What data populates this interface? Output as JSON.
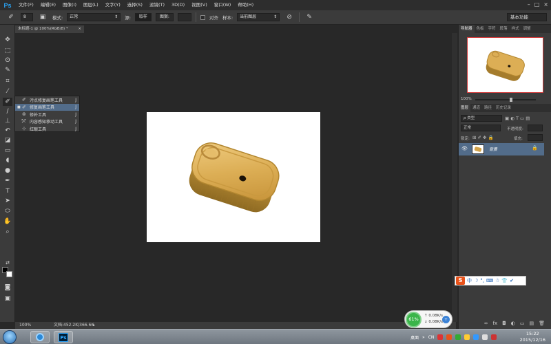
{
  "app": {
    "logo": "Ps",
    "menu": [
      "文件(F)",
      "编辑(E)",
      "图像(I)",
      "图层(L)",
      "文字(Y)",
      "选择(S)",
      "滤镜(T)",
      "3D(D)",
      "视图(V)",
      "窗口(W)",
      "帮助(H)"
    ],
    "window_controls": [
      "–",
      "□",
      "×"
    ]
  },
  "options": {
    "brush_size": "8",
    "mode_label": "模式:",
    "mode_value": "正常",
    "source_label": "源:",
    "source_sampled": "取样",
    "source_pattern": "图案:",
    "aligned_label": "对齐",
    "sample_label": "样本:",
    "sample_value": "当前图层",
    "workspace": "基本功能"
  },
  "document": {
    "tab_title": "未标题-1 @ 100%(RGB/8) *",
    "close": "×",
    "canvas_background": "#ffffff"
  },
  "tools": [
    {
      "name": "move-tool-icon",
      "glyph": "✥"
    },
    {
      "name": "marquee-tool-icon",
      "glyph": "⬚"
    },
    {
      "name": "lasso-tool-icon",
      "glyph": "ʘ"
    },
    {
      "name": "quick-select-tool-icon",
      "glyph": "✎"
    },
    {
      "name": "crop-tool-icon",
      "glyph": "⌗"
    },
    {
      "name": "eyedropper-tool-icon",
      "glyph": "⁄"
    },
    {
      "name": "healing-brush-tool-icon",
      "glyph": "✐"
    },
    {
      "name": "brush-tool-icon",
      "glyph": "∕"
    },
    {
      "name": "clone-stamp-tool-icon",
      "glyph": "⊥"
    },
    {
      "name": "history-brush-tool-icon",
      "glyph": "↶"
    },
    {
      "name": "eraser-tool-icon",
      "glyph": "◪"
    },
    {
      "name": "gradient-tool-icon",
      "glyph": "▭"
    },
    {
      "name": "blur-tool-icon",
      "glyph": "◖"
    },
    {
      "name": "dodge-tool-icon",
      "glyph": "●"
    },
    {
      "name": "pen-tool-icon",
      "glyph": "✒"
    },
    {
      "name": "type-tool-icon",
      "glyph": "T"
    },
    {
      "name": "path-select-tool-icon",
      "glyph": "➤"
    },
    {
      "name": "shape-tool-icon",
      "glyph": "⬭"
    },
    {
      "name": "hand-tool-icon",
      "glyph": "✋"
    },
    {
      "name": "zoom-tool-icon",
      "glyph": "⌕"
    }
  ],
  "flyout": [
    {
      "label": "污点修复画笔工具",
      "key": "J",
      "selected": false
    },
    {
      "label": "修复画笔工具",
      "key": "J",
      "selected": true
    },
    {
      "label": "修补工具",
      "key": "J",
      "selected": false
    },
    {
      "label": "内容感知移动工具",
      "key": "J",
      "selected": false
    },
    {
      "label": "红眼工具",
      "key": "J",
      "selected": false
    }
  ],
  "status": {
    "zoom": "100%",
    "doc_info": "文档:452.2K/366.6K",
    "arrow": "▸"
  },
  "navigator": {
    "tabs": [
      "导航器",
      "色板",
      "字符",
      "段落",
      "样式",
      "调整"
    ],
    "zoom": "100%"
  },
  "layers": {
    "tabs": [
      "图层",
      "通道",
      "路径",
      "历史记录"
    ],
    "filter_kind": "ρ 类型",
    "blend_mode": "正常",
    "opacity_label": "不透明度:",
    "lock_label": "锁定:",
    "fill_label": "填充:",
    "items": [
      {
        "name": "背景",
        "visible_icon": "👁",
        "lock_icon": "🔒"
      }
    ],
    "footer_icons": [
      "∞",
      "fx",
      "◘",
      "◐",
      "▭",
      "▤",
      "🗑"
    ]
  },
  "ime": {
    "logo": "S",
    "lang": "中",
    "icons": [
      "☽",
      "°,",
      "⌨",
      "☃",
      "👕",
      "✔"
    ]
  },
  "network": {
    "percent": "61%",
    "up": "↑  0.08K/s",
    "down": "↓  0.08K/s",
    "btn": "+"
  },
  "taskbar": {
    "desktop": "桌面",
    "lang": "CN",
    "time": "15:22",
    "date": "2015/12/16"
  },
  "colors": {
    "selection_blue": "#526c8a",
    "ps_blue": "#31a8ff",
    "navigator_frame": "#d23c3c"
  }
}
